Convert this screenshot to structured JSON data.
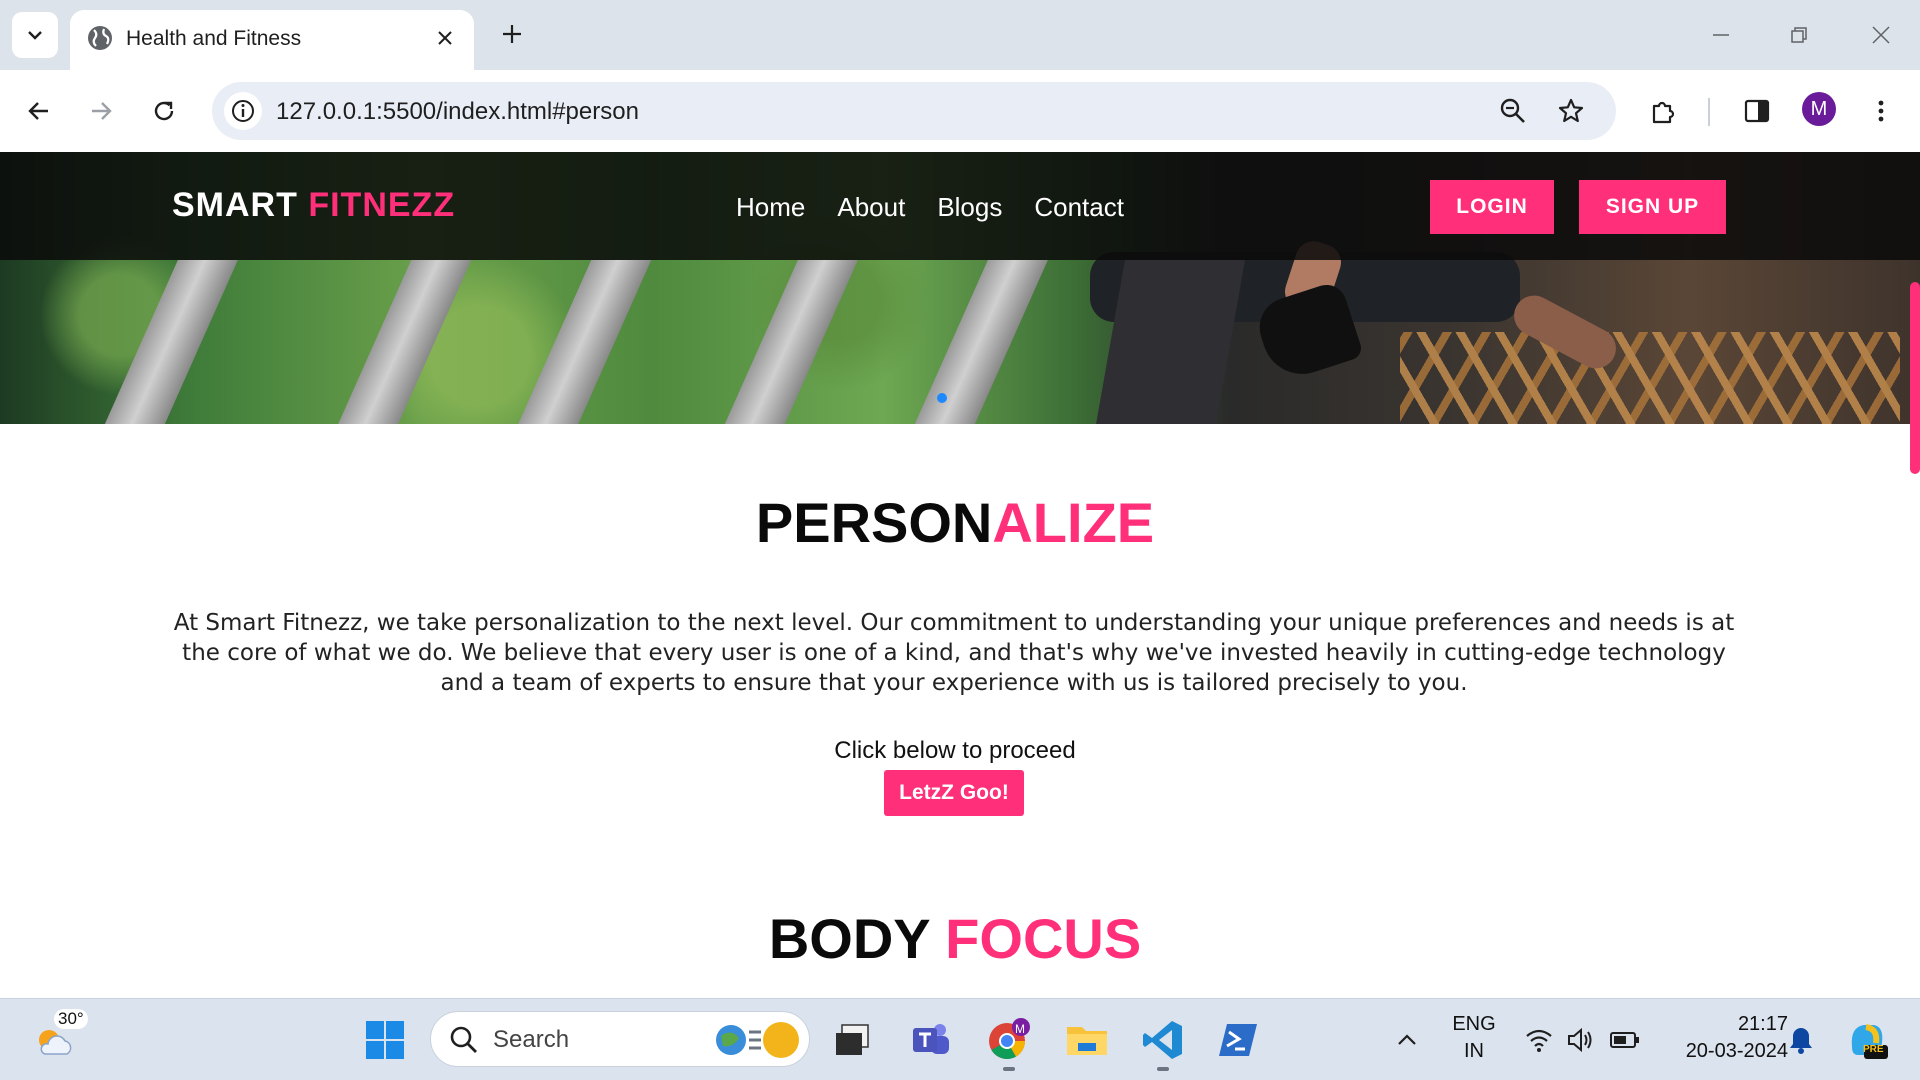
{
  "browser": {
    "tab_title": "Health and Fitness",
    "url": "127.0.0.1:5500/index.html#person",
    "profile_initial": "M"
  },
  "site": {
    "brand_part1": "SMART",
    "brand_part2": "FITNEZZ",
    "nav": [
      {
        "label": "Home"
      },
      {
        "label": "About"
      },
      {
        "label": "Blogs"
      },
      {
        "label": "Contact"
      }
    ],
    "login_label": "LOGIN",
    "signup_label": "SIGN UP"
  },
  "personalize": {
    "title_part1": "PERSON",
    "title_part2": "ALIZE",
    "paragraph": "At Smart Fitnezz, we take personalization to the next level. Our commitment to understanding your unique preferences and needs is at the core of what we do. We believe that every user is one of a kind, and that's why we've invested heavily in cutting-edge technology and a team of experts to ensure that your experience with us is tailored precisely to you.",
    "proceed_text": "Click below to proceed",
    "button_label": "LetzZ Goo!"
  },
  "body_focus": {
    "title_part1": "BODY",
    "title_part2": "FOCUS"
  },
  "taskbar": {
    "weather_temp": "30°",
    "search_placeholder": "Search",
    "lang_line1": "ENG",
    "lang_line2": "IN",
    "time": "21:17",
    "date": "20-03-2024",
    "chrome_badge": "M",
    "copilot_badge": "PRE"
  },
  "colors": {
    "accent_pink": "#ff2f7a",
    "navbar_bg": "#0a0a0a",
    "chrome_bg": "#dde3ea",
    "carousel_dot": "#1e88ff"
  }
}
